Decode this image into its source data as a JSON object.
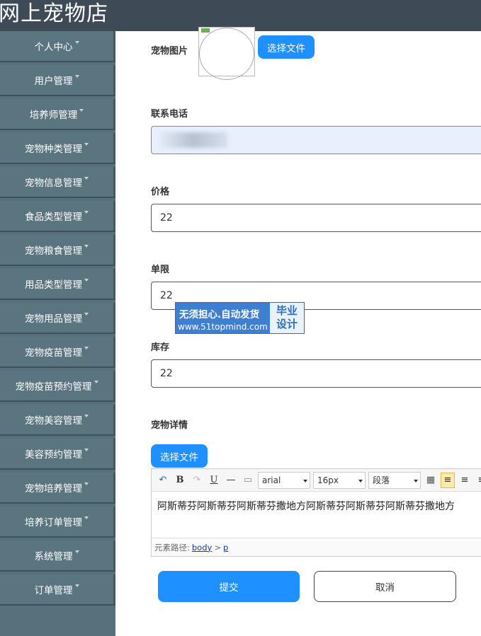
{
  "app": {
    "title": "网上宠物店"
  },
  "sidebar": {
    "items": [
      {
        "label": "个人中心"
      },
      {
        "label": "用户管理"
      },
      {
        "label": "培养师管理"
      },
      {
        "label": "宠物种类管理"
      },
      {
        "label": "宠物信息管理"
      },
      {
        "label": "食品类型管理"
      },
      {
        "label": "宠物粮食管理"
      },
      {
        "label": "用品类型管理"
      },
      {
        "label": "宠物用品管理"
      },
      {
        "label": "宠物疫苗管理"
      },
      {
        "label": "宠物疫苗预约管理"
      },
      {
        "label": "宠物美容管理"
      },
      {
        "label": "美容预约管理"
      },
      {
        "label": "宠物培养管理"
      },
      {
        "label": "培养订单管理"
      },
      {
        "label": "系统管理"
      },
      {
        "label": "订单管理"
      }
    ]
  },
  "form": {
    "pet_image": {
      "label": "宠物图片",
      "button": "选择文件"
    },
    "phone": {
      "label": "联系电话",
      "value": ""
    },
    "price": {
      "label": "价格",
      "value": "22"
    },
    "limit": {
      "label": "单限",
      "value": "22"
    },
    "stock": {
      "label": "库存",
      "value": "22"
    },
    "details": {
      "label": "宠物详情",
      "upload_button": "选择文件",
      "font_family": "arial",
      "font_size": "16px",
      "paragraph": "段落",
      "content": "阿斯蒂芬阿斯蒂芬阿斯蒂芬撒地方阿斯蒂芬阿斯蒂芬阿斯蒂芬撒地方",
      "path_label": "元素路径:",
      "path_body": "body",
      "path_sep": ">",
      "path_p": "p"
    },
    "submit": "提交",
    "cancel": "取消"
  },
  "watermark": {
    "line1": "无须担心.自动发货",
    "line2": "www.51topmind.com",
    "badge_line1": "毕业",
    "badge_line2": "设计"
  },
  "colors": {
    "header": "#3f4a57",
    "sidebar": "#5a7480",
    "primary": "#1e90ff"
  }
}
